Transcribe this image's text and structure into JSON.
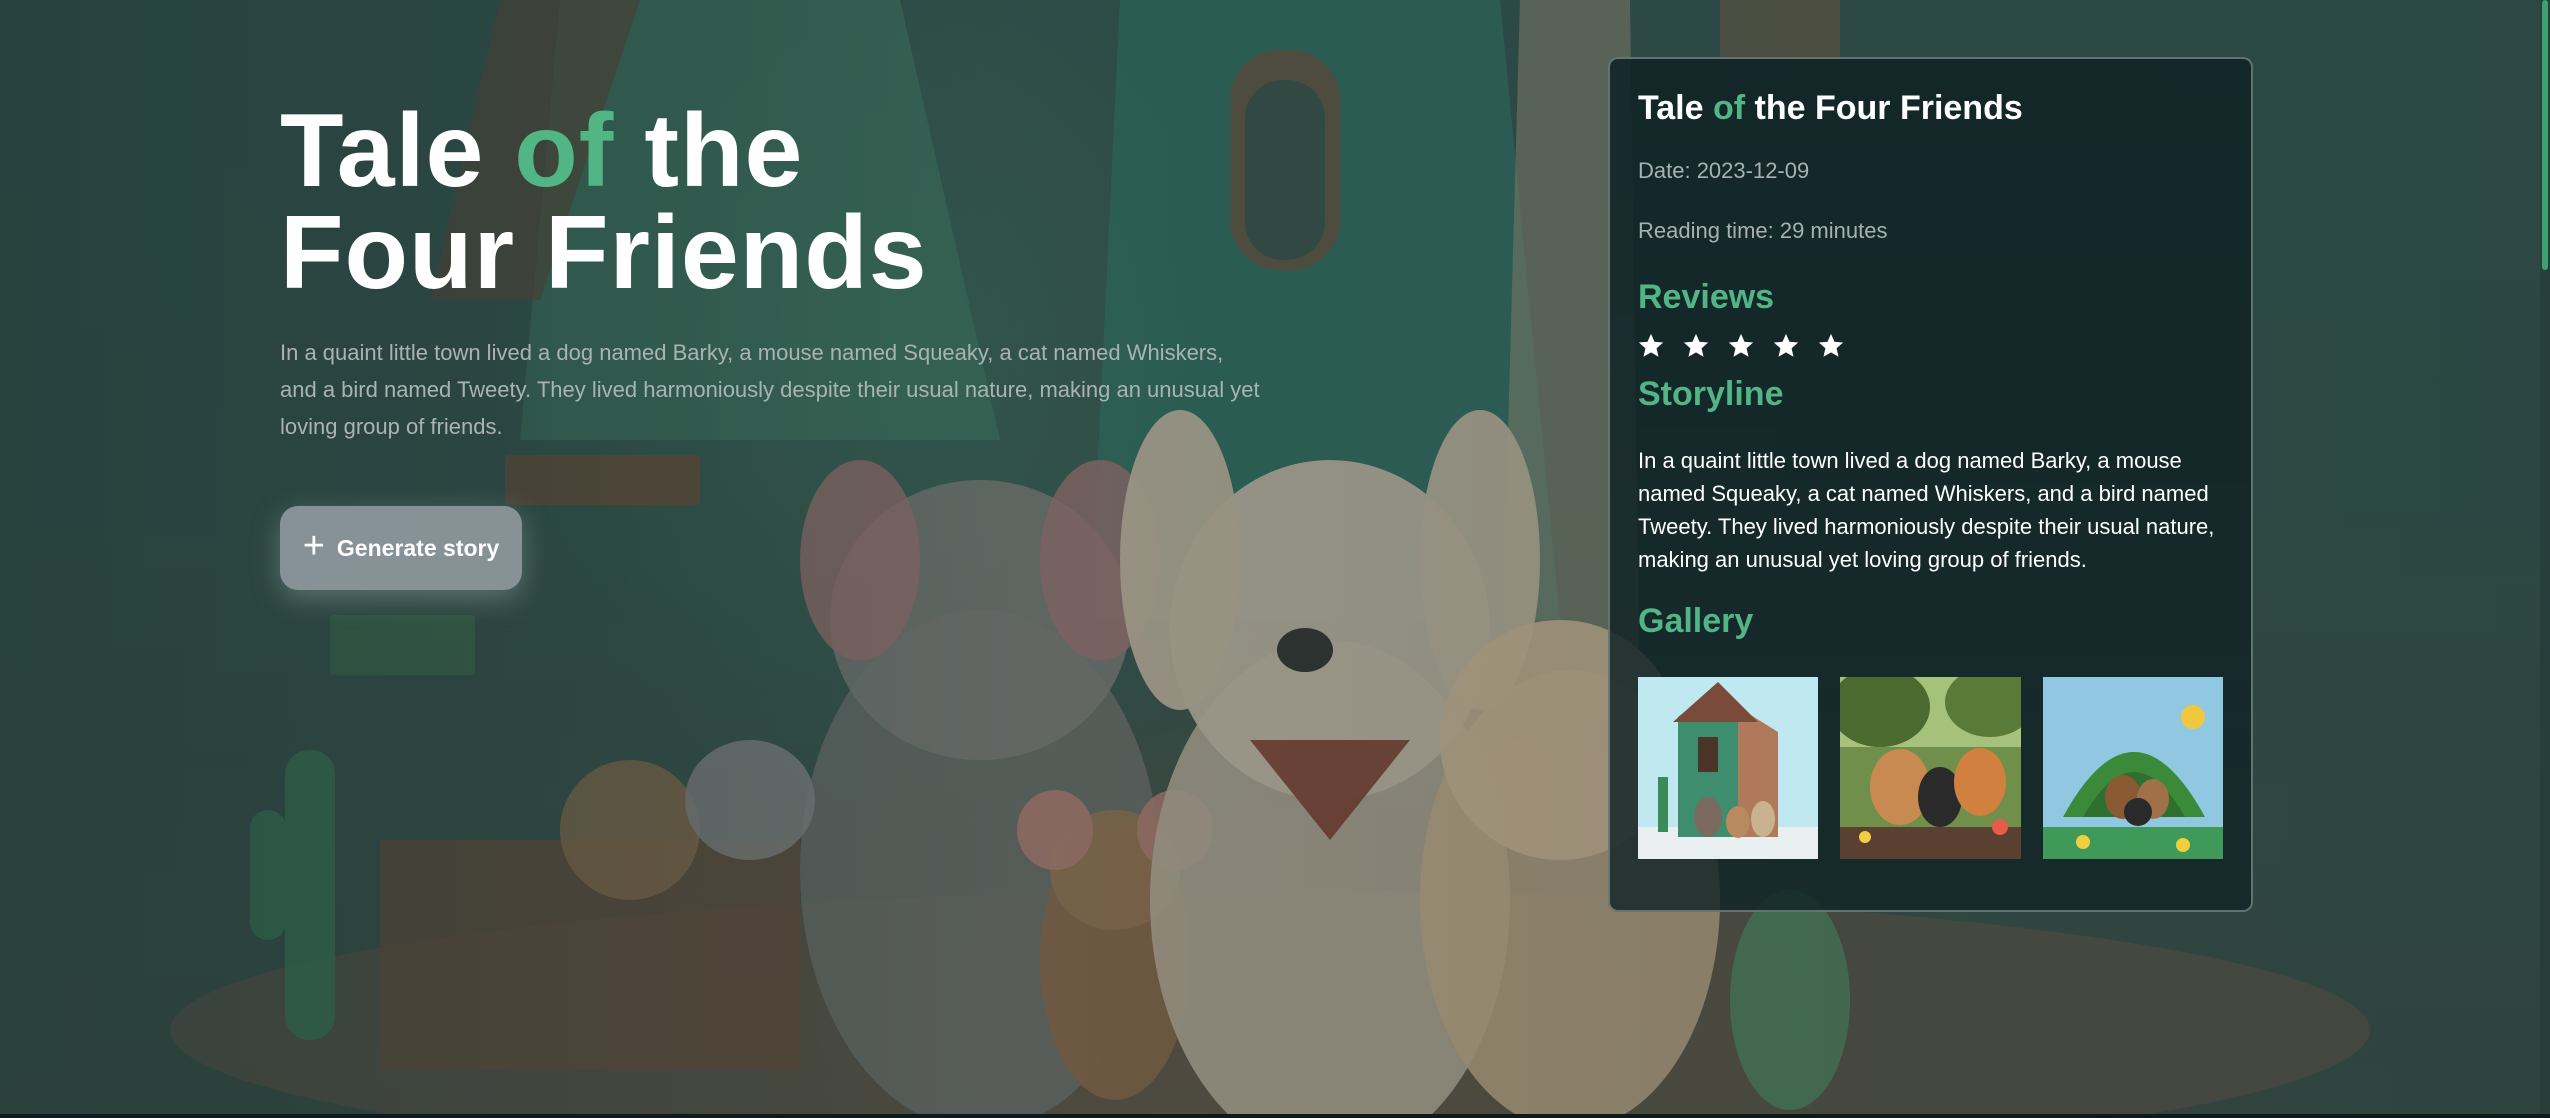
{
  "hero": {
    "title_part1": "Tale ",
    "title_accent": "of",
    "title_part2": " the",
    "title_line2": "Four Friends",
    "description": "In a quaint little town lived a dog named Barky, a mouse named Squeaky, a cat named Whiskers, and a bird named Tweety. They lived harmoniously despite their usual nature, making an unusual yet loving group of friends.",
    "button_label": "Generate story",
    "button_icon": "plus-icon"
  },
  "card": {
    "title_part1": "Tale ",
    "title_accent": "of",
    "title_part2": " the Four Friends",
    "date": "Date: 2023-12-09",
    "reading_time": "Reading time: 29 minutes",
    "reviews_heading": "Reviews",
    "rating": 5,
    "rating_max": 5,
    "storyline_heading": "Storyline",
    "storyline": "In a quaint little town lived a dog named Barky, a mouse named Squeaky, a cat named Whiskers, and a bird named Tweety. They lived harmoniously despite their usual nature, making an unusual yet loving group of friends.",
    "gallery_heading": "Gallery"
  },
  "colors": {
    "accent": "#52b585",
    "background": "#2e4442",
    "card_bg": "#122426"
  }
}
